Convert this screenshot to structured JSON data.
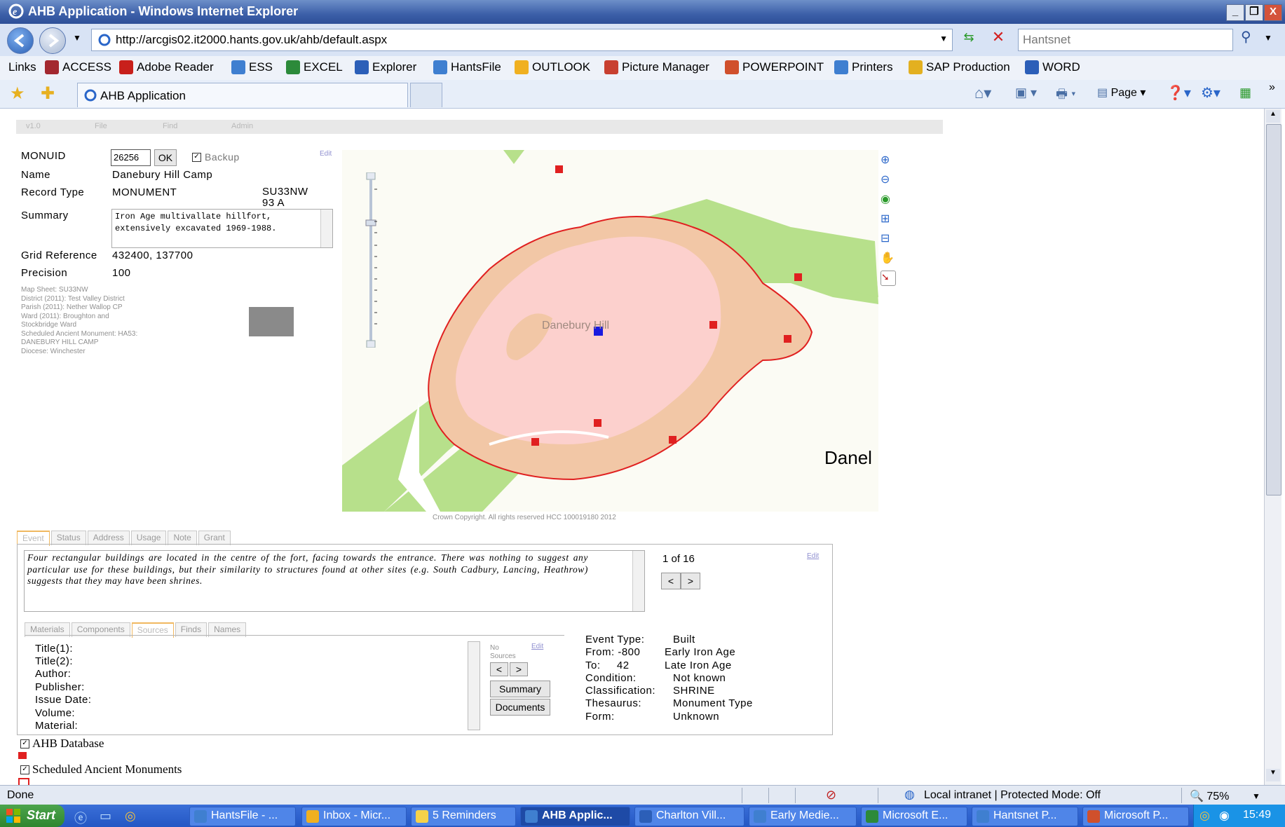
{
  "window": {
    "title": "AHB Application - Windows Internet Explorer",
    "buttons": [
      "_",
      "❐",
      "X"
    ]
  },
  "address_bar": {
    "url": "http://arcgis02.it2000.hants.gov.uk/ahb/default.aspx",
    "search_placeholder": "Hantsnet"
  },
  "links_bar": {
    "label": "Links",
    "items": [
      {
        "label": "ACCESS",
        "color": "#a3282f"
      },
      {
        "label": "Adobe Reader",
        "color": "#c8201b"
      },
      {
        "label": "ESS",
        "color": "#3f7fd0"
      },
      {
        "label": "EXCEL",
        "color": "#2c8a3a"
      },
      {
        "label": "Explorer",
        "color": "#2c5fb8"
      },
      {
        "label": "HantsFile",
        "color": "#3f7fd0"
      },
      {
        "label": "OUTLOOK",
        "color": "#f0b020"
      },
      {
        "label": "Picture Manager",
        "color": "#c84030"
      },
      {
        "label": "POWERPOINT",
        "color": "#d0502c"
      },
      {
        "label": "Printers",
        "color": "#3f7fd0"
      },
      {
        "label": "SAP Production",
        "color": "#e3b020"
      },
      {
        "label": "WORD",
        "color": "#2c5fb8"
      }
    ]
  },
  "tabs": {
    "active_tab": "AHB Application",
    "page_menu": "Page"
  },
  "app_menu": [
    "v1.0",
    "File",
    "Find",
    "Admin"
  ],
  "record": {
    "monuid_label": "MONUID",
    "monuid_value": "26256",
    "ok_label": "OK",
    "backup_label": "Backup",
    "edit_label": "Edit",
    "name_label": "Name",
    "name_value": "Danebury Hill Camp",
    "type_label": "Record Type",
    "type_value": "MONUMENT",
    "ref_line1": "SU33NW",
    "ref_line2": "93 A",
    "summary_label": "Summary",
    "summary_text": "Iron Age multivallate hillfort, extensively excavated 1969-1988.",
    "grid_label": "Grid Reference",
    "grid_value": "432400, 137700",
    "precision_label": "Precision",
    "precision_value": "100",
    "details": [
      "Map Sheet: SU33NW",
      "District (2011): Test Valley District",
      "Parish (2011): Nether Wallop CP",
      "Ward (2011): Broughton and",
      "Stockbridge Ward",
      "Scheduled Ancient Monument: HA53:",
      "DANEBURY HILL CAMP",
      "Diocese: Winchester"
    ]
  },
  "map": {
    "place_label": "Danebury Hill",
    "edge_label": "Danel",
    "copyright": "Crown Copyright.  All rights reserved HCC 100019180 2012"
  },
  "event_tabs": [
    "Event",
    "Status",
    "Address",
    "Usage",
    "Note",
    "Grant"
  ],
  "event": {
    "text": "Four rectangular buildings are located in the centre of the fort, facing towards the entrance. There was nothing to suggest any particular use for these buildings, but their similarity to structures found at other sites (e.g. South Cadbury, Lancing, Heathrow) suggests that they may have been shrines.",
    "counter": "1 of 16",
    "edit_label": "Edit",
    "prev": "<",
    "next": ">"
  },
  "sub_tabs": [
    "Materials",
    "Components",
    "Sources",
    "Finds",
    "Names"
  ],
  "sources": {
    "fields": [
      "Title(1):",
      "Title(2):",
      "Author:",
      "Publisher:",
      "Issue Date:",
      "Volume:",
      "Material:"
    ],
    "no_sources_line1": "No",
    "no_sources_line2": "Sources",
    "edit_label": "Edit",
    "summary_btn": "Summary",
    "documents_btn": "Documents"
  },
  "event_details": [
    {
      "key": "Event Type:",
      "value": "Built"
    },
    {
      "key": "From:  -800",
      "value": "Early Iron Age"
    },
    {
      "key": "To:     42",
      "value": "Late Iron Age"
    },
    {
      "key": "Condition:",
      "value": "Not known"
    },
    {
      "key": "Classification:",
      "value": "SHRINE"
    },
    {
      "key": "Thesaurus:",
      "value": "Monument Type"
    },
    {
      "key": "Form:",
      "value": "Unknown"
    }
  ],
  "layers": [
    "AHB Database",
    "Scheduled Ancient Monuments"
  ],
  "status_bar": {
    "text": "Done",
    "zone": "Local intranet | Protected Mode: Off",
    "zoom": "75%"
  },
  "taskbar": {
    "start": "Start",
    "tasks": [
      {
        "label": "HantsFile - ...",
        "color": "#3f7fd0"
      },
      {
        "label": "Inbox - Micr...",
        "color": "#f0b020"
      },
      {
        "label": "5 Reminders",
        "color": "#f6d24a"
      },
      {
        "label": "AHB Applic...",
        "color": "#3f7fd0"
      },
      {
        "label": "Charlton Vill...",
        "color": "#2c5fb8"
      },
      {
        "label": "Early Medie...",
        "color": "#3f7fd0"
      },
      {
        "label": "Microsoft E...",
        "color": "#2c8a3a"
      },
      {
        "label": "Hantsnet P...",
        "color": "#3f7fd0"
      },
      {
        "label": "Microsoft P...",
        "color": "#d0502c"
      }
    ],
    "clock": "15:49"
  }
}
